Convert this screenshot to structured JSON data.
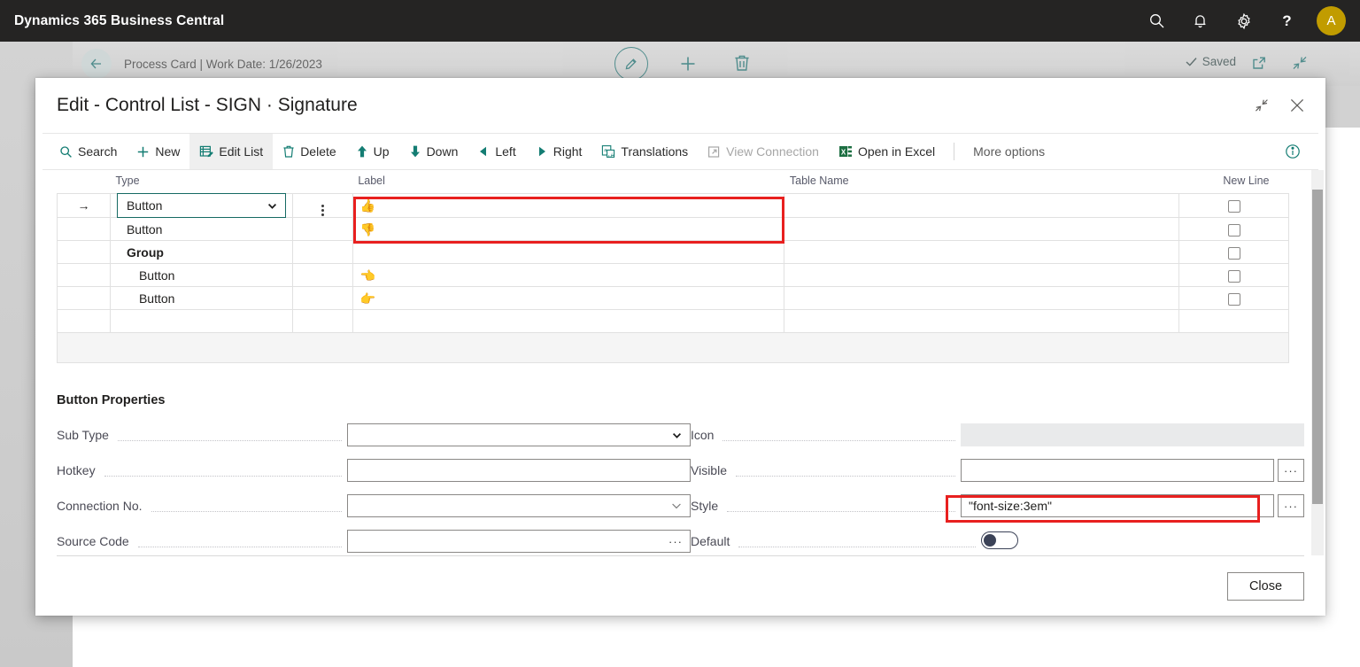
{
  "app": {
    "title": "Dynamics 365 Business Central",
    "nav_icons": [
      "search-icon",
      "bell-icon",
      "gear-icon",
      "help-icon"
    ],
    "avatar_initial": "A",
    "avatar_color": "#c19c00"
  },
  "background_page": {
    "breadcrumb": "Process Card | Work Date: 1/26/2023",
    "saved_label": "Saved",
    "icons": [
      "back-arrow-icon",
      "pencil-icon",
      "plus-icon",
      "trash-icon",
      "open-in-new-icon",
      "shrink-icon"
    ]
  },
  "dialog": {
    "title": "Edit - Control List - SIGN · Signature",
    "header_actions": [
      {
        "name": "restore-down-button",
        "label": ""
      },
      {
        "name": "close-dialog-button",
        "label": ""
      }
    ],
    "toolbar": [
      {
        "label": "Search",
        "icon": "search-icon",
        "state": "normal"
      },
      {
        "label": "New",
        "icon": "plus-icon",
        "state": "normal"
      },
      {
        "label": "Edit List",
        "icon": "edit-list-icon",
        "state": "active"
      },
      {
        "label": "Delete",
        "icon": "trash-icon",
        "state": "normal"
      },
      {
        "label": "Up",
        "icon": "arrow-up-icon",
        "state": "normal"
      },
      {
        "label": "Down",
        "icon": "arrow-down-icon",
        "state": "normal"
      },
      {
        "label": "Left",
        "icon": "arrow-left-icon",
        "state": "normal"
      },
      {
        "label": "Right",
        "icon": "arrow-right-icon",
        "state": "normal"
      },
      {
        "label": "Translations",
        "icon": "translations-icon",
        "state": "normal"
      },
      {
        "label": "View Connection",
        "icon": "view-connection-icon",
        "state": "disabled"
      },
      {
        "label": "Open in Excel",
        "icon": "excel-icon",
        "state": "normal"
      },
      {
        "label": "More options",
        "icon": "",
        "state": "plain"
      }
    ],
    "toolbar_info_icon": "info-icon",
    "grid": {
      "columns": [
        "",
        "Type",
        "",
        "Label",
        "Table Name",
        "New Line"
      ],
      "rows": [
        {
          "selector": "→",
          "type": "Button",
          "type_editing": true,
          "indent": false,
          "bold": false,
          "label": "👍",
          "table_name": "",
          "new_line": false
        },
        {
          "selector": "",
          "type": "Button",
          "type_editing": false,
          "indent": false,
          "bold": false,
          "label": "👎",
          "table_name": "",
          "new_line": false
        },
        {
          "selector": "",
          "type": "Group",
          "type_editing": false,
          "indent": false,
          "bold": true,
          "label": "",
          "table_name": "",
          "new_line": false
        },
        {
          "selector": "",
          "type": "Button",
          "type_editing": false,
          "indent": true,
          "bold": false,
          "label": "👈",
          "table_name": "",
          "new_line": false
        },
        {
          "selector": "",
          "type": "Button",
          "type_editing": false,
          "indent": true,
          "bold": false,
          "label": "👉",
          "table_name": "",
          "new_line": false
        },
        {
          "selector": "",
          "type": "",
          "type_editing": false,
          "indent": false,
          "bold": false,
          "label": "",
          "table_name": "",
          "new_line": null
        }
      ]
    },
    "properties": {
      "heading": "Button Properties",
      "left": [
        {
          "label": "Sub Type",
          "value": "",
          "control": "dropdown"
        },
        {
          "label": "Hotkey",
          "value": "",
          "control": "text"
        },
        {
          "label": "Connection No.",
          "value": "",
          "control": "lookup"
        },
        {
          "label": "Source Code",
          "value": "",
          "control": "assist-inline"
        }
      ],
      "right": [
        {
          "label": "Icon",
          "value": "",
          "control": "readonly"
        },
        {
          "label": "Visible",
          "value": "",
          "control": "assist"
        },
        {
          "label": "Style",
          "value": "\"font-size:3em\"",
          "control": "assist",
          "highlighted": true
        },
        {
          "label": "Default",
          "value": "off",
          "control": "toggle"
        }
      ]
    },
    "footer": {
      "close_label": "Close"
    }
  },
  "annotations": {
    "highlight_color": "#e8201f",
    "boxes": [
      "label-column-highlight",
      "style-field-highlight"
    ]
  }
}
